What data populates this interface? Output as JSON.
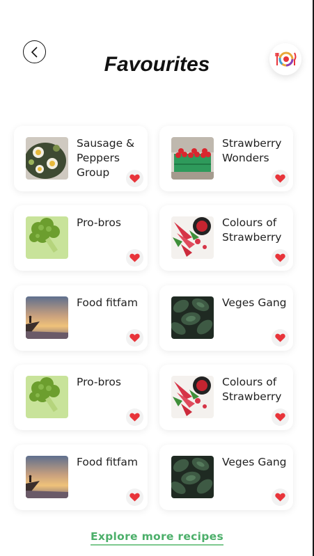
{
  "header": {
    "title": "Favourites",
    "back_icon": "chevron-left-icon",
    "logo_icon": "fork-knife-plate-icon"
  },
  "favourites": [
    {
      "label": "Sausage & Peppers Group",
      "image": "food-bowl-image"
    },
    {
      "label": "Strawberry Wonders",
      "image": "strawberry-market-image"
    },
    {
      "label": "Pro-bros",
      "image": "broccoli-image"
    },
    {
      "label": "Colours of Strawberry",
      "image": "strawberry-bowl-image"
    },
    {
      "label": "Food fitfam",
      "image": "sunset-hiker-image"
    },
    {
      "label": "Veges Gang",
      "image": "green-leaves-image"
    },
    {
      "label": "Pro-bros",
      "image": "broccoli-image"
    },
    {
      "label": "Colours of Strawberry",
      "image": "strawberry-bowl-image"
    },
    {
      "label": "Food fitfam",
      "image": "sunset-hiker-image"
    },
    {
      "label": "Veges Gang",
      "image": "green-leaves-image"
    }
  ],
  "footer": {
    "explore_label": "Explore more recipes"
  },
  "colors": {
    "heart": "#e8343a",
    "link": "#4caf6a",
    "link_underline": "#7dc88f"
  }
}
